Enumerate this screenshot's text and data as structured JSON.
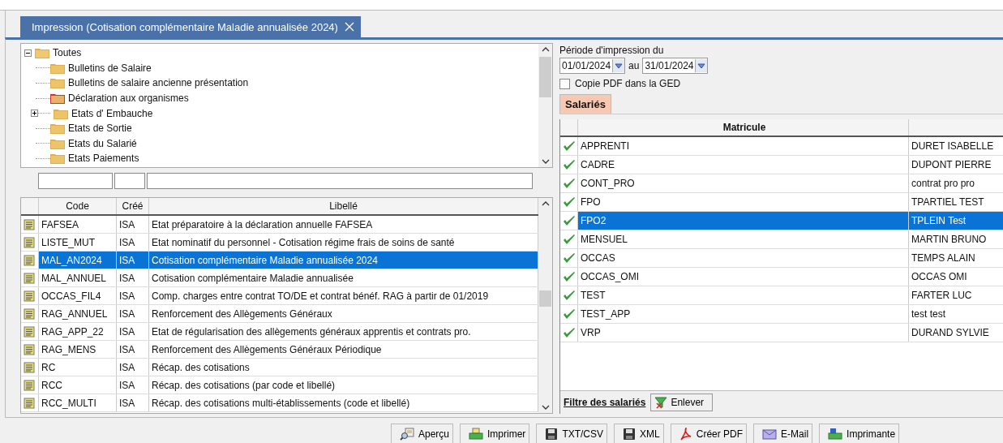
{
  "tab": {
    "title": "Impression (Cotisation complémentaire Maladie annualisée 2024)",
    "selected": true
  },
  "tree": {
    "label": "Toutes",
    "expanded": true,
    "children": [
      {
        "label": "Bulletins de Salaire",
        "color": "#e0b050",
        "kind": "leaf"
      },
      {
        "label": "Bulletins de salaire ancienne présentation",
        "color": "#e0b050",
        "kind": "leaf"
      },
      {
        "label": "Déclaration aux organismes",
        "color": "#c8383a",
        "kind": "leaf"
      },
      {
        "label": "Etats d' Embauche",
        "color": "#e0b050",
        "kind": "branch",
        "expanded": false
      },
      {
        "label": "Etats de Sortie",
        "color": "#e0b050",
        "kind": "leaf"
      },
      {
        "label": "Etats du Salarié",
        "color": "#e0b050",
        "kind": "leaf"
      },
      {
        "label": "Etats Paiements",
        "color": "#e0b050",
        "kind": "leaf"
      }
    ]
  },
  "reports": {
    "columns": [
      "Code",
      "Créé",
      "Libellé"
    ],
    "rows": [
      {
        "code": "FAFSEA",
        "created": "ISA",
        "label": "Etat préparatoire à la déclaration annuelle FAFSEA",
        "selected": false
      },
      {
        "code": "LISTE_MUT",
        "created": "ISA",
        "label": "Etat nominatif du personnel - Cotisation régime frais de soins de santé",
        "selected": false
      },
      {
        "code": "MAL_AN2024",
        "created": "ISA",
        "label": "Cotisation complémentaire Maladie annualisée 2024",
        "selected": true
      },
      {
        "code": "MAL_ANNUEL",
        "created": "ISA",
        "label": "Cotisation complémentaire Maladie annualisée",
        "selected": false
      },
      {
        "code": "OCCAS_FIL4",
        "created": "ISA",
        "label": "Comp. charges entre contrat TO/DE et contrat bénéf. RAG à partir de 01/2019",
        "selected": false
      },
      {
        "code": "RAG_ANNUEL",
        "created": "ISA",
        "label": "Renforcement des Allègements Généraux",
        "selected": false
      },
      {
        "code": "RAG_APP_22",
        "created": "ISA",
        "label": "Etat de régularisation des allègements généraux apprentis et contrats pro.",
        "selected": false
      },
      {
        "code": "RAG_MENS",
        "created": "ISA",
        "label": "Renforcement des Allègements Généraux Périodique",
        "selected": false
      },
      {
        "code": "RC",
        "created": "ISA",
        "label": "Récap. des cotisations",
        "selected": false
      },
      {
        "code": "RCC",
        "created": "ISA",
        "label": "Récap. des cotisations (par code et libellé)",
        "selected": false
      },
      {
        "code": "RCC_MULTI",
        "created": "ISA",
        "label": "Récap. des cotisations multi-établissements (code et libellé)",
        "selected": false
      }
    ]
  },
  "period": {
    "label": "Période d'impression du",
    "from": "01/01/2024",
    "separator": "au",
    "to": "31/01/2024"
  },
  "pdf_copy": {
    "label": "Copie PDF dans la GED",
    "checked": false
  },
  "subtabs": [
    {
      "label": "Salariés",
      "selected": true
    }
  ],
  "employees": {
    "columns": [
      "Matricule"
    ],
    "rows": [
      {
        "matricule": "APPRENTI",
        "name": "DURET ISABELLE",
        "checked": true,
        "selected": false
      },
      {
        "matricule": "CADRE",
        "name": "DUPONT PIERRE",
        "checked": true,
        "selected": false
      },
      {
        "matricule": "CONT_PRO",
        "name": "contrat pro pro",
        "checked": true,
        "selected": false
      },
      {
        "matricule": "FPO",
        "name": "TPARTIEL TEST",
        "checked": true,
        "selected": false
      },
      {
        "matricule": "FPO2",
        "name": "TPLEIN Test",
        "checked": true,
        "selected": true
      },
      {
        "matricule": "MENSUEL",
        "name": "MARTIN BRUNO",
        "checked": true,
        "selected": false
      },
      {
        "matricule": "OCCAS",
        "name": "TEMPS ALAIN",
        "checked": true,
        "selected": false
      },
      {
        "matricule": "OCCAS_OMI",
        "name": "OCCAS OMI",
        "checked": true,
        "selected": false
      },
      {
        "matricule": "TEST",
        "name": "FARTER LUC",
        "checked": true,
        "selected": false
      },
      {
        "matricule": "TEST_APP",
        "name": "test test",
        "checked": true,
        "selected": false
      },
      {
        "matricule": "VRP",
        "name": "DURAND SYLVIE",
        "checked": true,
        "selected": false
      }
    ]
  },
  "filter": {
    "label": "Filtre des salariés",
    "button": "Enlever"
  },
  "actions": [
    {
      "kind": "preview",
      "label": "Aperçu"
    },
    {
      "kind": "print",
      "label": "Imprimer"
    },
    {
      "kind": "save",
      "label": "TXT/CSV"
    },
    {
      "kind": "save",
      "label": "XML"
    },
    {
      "kind": "pdf",
      "label": "Créer PDF"
    },
    {
      "kind": "mail",
      "label": "E-Mail"
    },
    {
      "kind": "printer",
      "label": "Imprimante"
    }
  ]
}
